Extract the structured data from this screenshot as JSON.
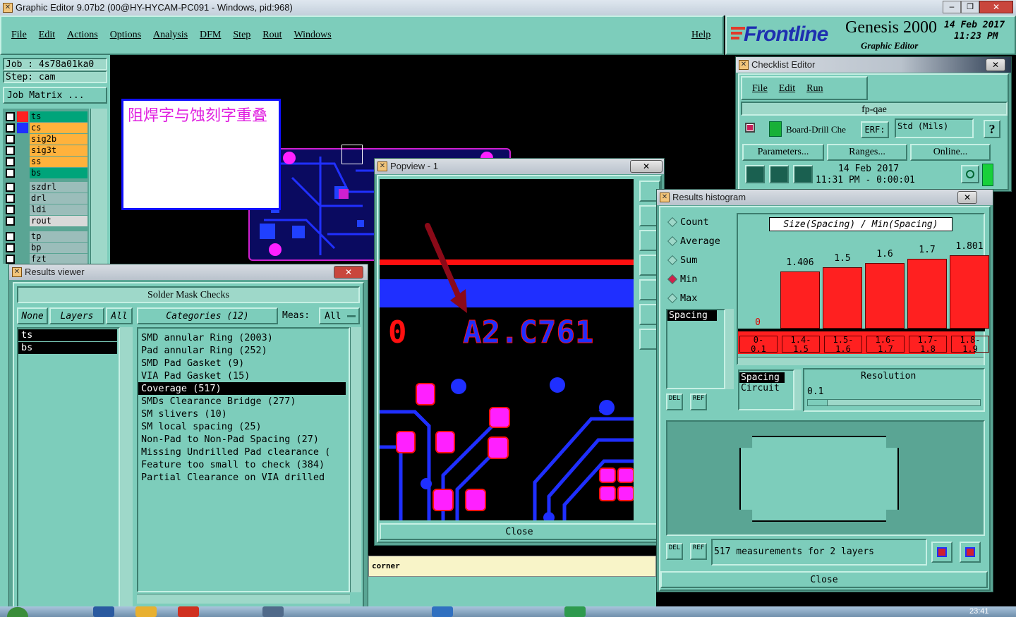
{
  "titlebar": {
    "text": "Graphic Editor 9.07b2 (00@HY-HYCAM-PC091 - Windows, pid:968)"
  },
  "menu": [
    "File",
    "Edit",
    "Actions",
    "Options",
    "Analysis",
    "DFM",
    "Step",
    "Rout",
    "Windows"
  ],
  "help_label": "Help",
  "brand": {
    "logo": "Frontline",
    "product": "Genesis 2000",
    "subtitle": "Graphic Editor",
    "date": "14 Feb 2017",
    "time": "11:23 PM"
  },
  "job": {
    "job_line": "Job : 4s78a01ka0",
    "step_line": "Step: cam",
    "matrix_label": "Job Matrix ..."
  },
  "layers": [
    {
      "name": "ts",
      "color": "#00a47a",
      "mark": "#ff2020"
    },
    {
      "name": "cs",
      "color": "#ffb23c",
      "mark": "#1f2fff"
    },
    {
      "name": "sig2b",
      "color": "#ffb23c",
      "mark": ""
    },
    {
      "name": "sig3t",
      "color": "#ffb23c",
      "mark": ""
    },
    {
      "name": "ss",
      "color": "#ffb23c",
      "mark": ""
    },
    {
      "name": "bs",
      "color": "#00a47a",
      "mark": ""
    },
    {
      "name": "szdrl",
      "color": "#9bbdba",
      "mark": ""
    },
    {
      "name": "drl",
      "color": "#9bbdba",
      "mark": ""
    },
    {
      "name": "ldi",
      "color": "#9bbdba",
      "mark": ""
    },
    {
      "name": "rout",
      "color": "#d9d9d9",
      "mark": ""
    },
    {
      "name": "tp",
      "color": "#9bbdba",
      "mark": ""
    },
    {
      "name": "bp",
      "color": "#9bbdba",
      "mark": ""
    },
    {
      "name": "fzt",
      "color": "#9bbdba",
      "mark": ""
    }
  ],
  "note_text": "阻焊字与蚀刻字重叠",
  "results_viewer": {
    "title": "Results viewer",
    "header": "Solder Mask Checks",
    "none_btn": "None",
    "layers_btn": "Layers",
    "all_btn": "All",
    "categories_btn": "Categories (12)",
    "meas_label": "Meas:",
    "meas_value": "All",
    "layer_list": [
      "ts",
      "bs"
    ],
    "categories": [
      "SMD annular Ring (2003)",
      "Pad annular Ring (252)",
      "SMD Pad Gasket (9)",
      "VIA Pad Gasket (15)",
      "Coverage (517)",
      "SMDs Clearance Bridge (277)",
      "SM slivers (10)",
      "SM local spacing (25)",
      "Non-Pad to Non-Pad Spacing (27)",
      "Missing Undrilled Pad clearance (",
      "Feature too small to check (384)",
      "Partial Clearance on VIA drilled"
    ],
    "selected_index": 4
  },
  "popview": {
    "title": "Popview - 1",
    "close_label": "Close",
    "text_left": "0",
    "text_right": "A2.C761"
  },
  "status_text": "corner",
  "checklist": {
    "title": "Checklist Editor",
    "menu": [
      "File",
      "Edit",
      "Run"
    ],
    "name": "fp-qae",
    "row_label": "Board-Drill Che",
    "erf_label": "ERF:",
    "erf_value": "Std (Mils)",
    "help_glyph": "?",
    "buttons": [
      "Parameters...",
      "Ranges...",
      "Online..."
    ],
    "run_date": "14 Feb 2017",
    "run_time": "11:31 PM - 0:00:01"
  },
  "histogram": {
    "title": "Results histogram",
    "options": [
      "Count",
      "Average",
      "Sum",
      "Min",
      "Max"
    ],
    "selected_option": "Min",
    "measure_list": [
      "Spacing"
    ],
    "del_label": "DEL",
    "ref_label": "REF",
    "chart_title": "Size(Spacing) / Min(Spacing)",
    "type_list": [
      "Spacing",
      "Circuit"
    ],
    "resolution_label": "Resolution",
    "resolution_value": "0.1",
    "summary": "517 measurements for 2 layers",
    "close_label": "Close"
  },
  "chart_data": {
    "type": "bar",
    "title": "Size(Spacing) / Min(Spacing)",
    "categories": [
      "0-0.1",
      "1.4-1.5",
      "1.5-1.6",
      "1.6-1.7",
      "1.7-1.8",
      "1.8-1.9"
    ],
    "values": [
      0,
      1.406,
      1.5,
      1.6,
      1.7,
      1.801
    ],
    "value_labels": [
      "0",
      "1.406",
      "1.5",
      "1.6",
      "1.7",
      "1.801"
    ],
    "bin_top": [
      "0-",
      "1.4-",
      "1.5-",
      "1.6-",
      "1.7-",
      "1.8-"
    ],
    "bin_bottom": [
      "0.1",
      "1.5",
      "1.6",
      "1.7",
      "1.8",
      "1.9"
    ],
    "ylim": [
      0,
      2.1
    ],
    "bar_color": "#ff2020"
  },
  "taskbar": {
    "clock": "23:41"
  }
}
